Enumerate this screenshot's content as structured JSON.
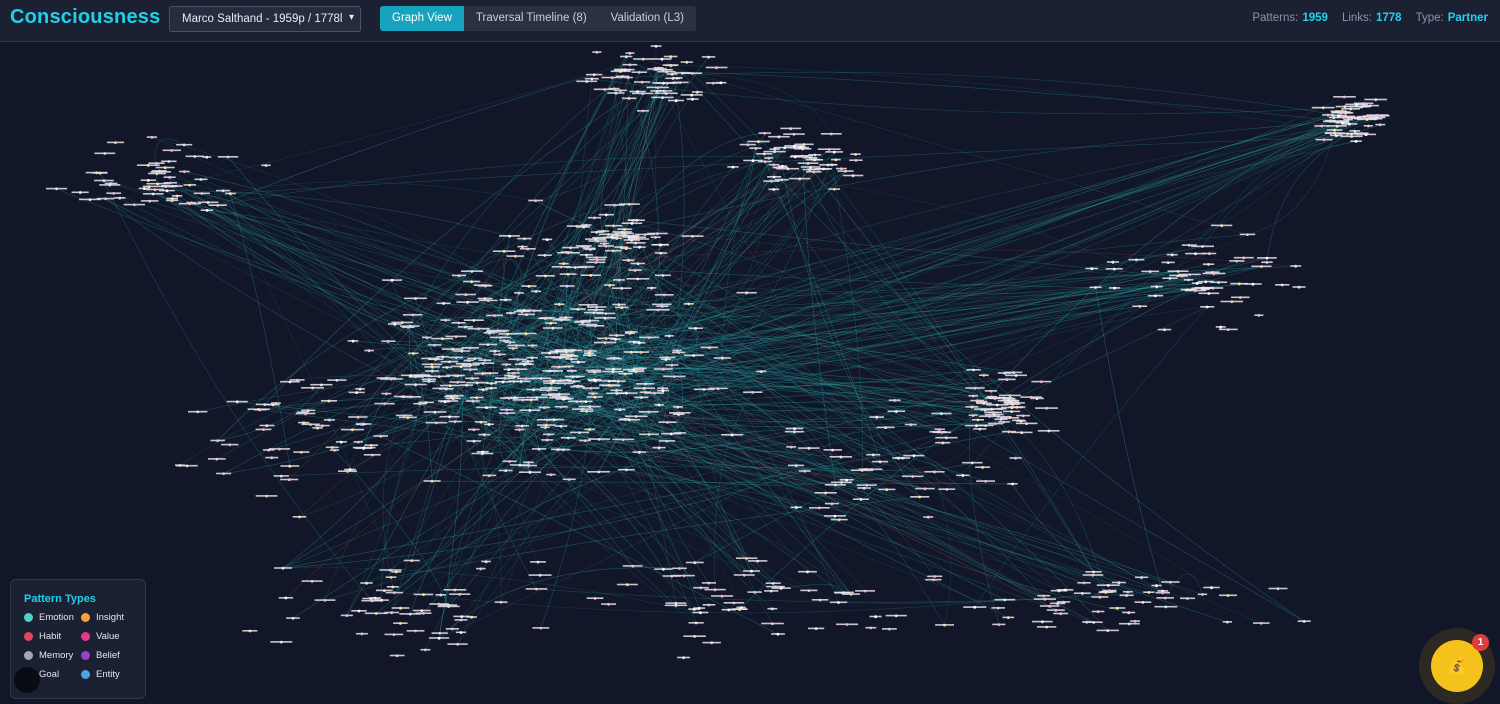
{
  "header": {
    "app_title": "Consciousness",
    "dataset_selector": {
      "selected": "Marco Salthand - 1959p / 1778l",
      "chevron_icon": "chevron-down-icon"
    },
    "tabs": [
      {
        "label": "Graph View",
        "active": true
      },
      {
        "label": "Traversal Timeline (8)",
        "active": false
      },
      {
        "label": "Validation (L3)",
        "active": false
      }
    ],
    "stats": {
      "patterns_label": "Patterns:",
      "patterns_value": "1959",
      "links_label": "Links:",
      "links_value": "1778",
      "type_label": "Type:",
      "type_value": "Partner"
    }
  },
  "legend": {
    "title": "Pattern Types",
    "items": [
      {
        "label": "Emotion",
        "color": "#4fd1c5"
      },
      {
        "label": "Insight",
        "color": "#f6a23a"
      },
      {
        "label": "Habit",
        "color": "#e0455a"
      },
      {
        "label": "Value",
        "color": "#e8388a"
      },
      {
        "label": "Memory",
        "color": "#a0a8b4"
      },
      {
        "label": "Belief",
        "color": "#9b40c9"
      },
      {
        "label": "Goal",
        "color": "#4fbf6a"
      },
      {
        "label": "Entity",
        "color": "#4aa3df"
      }
    ]
  },
  "graph": {
    "edge_color": "#2fa7a8",
    "node_colors": [
      "#f2e6d8",
      "#f6c9a8",
      "#d8c4f0",
      "#f5b5c8",
      "#cfe8f0",
      "#ffffff",
      "#ffe3a3"
    ],
    "node_count_shown": 1959,
    "link_count_shown": 1778
  },
  "floating_action": {
    "icon": "money-bag-icon",
    "glyph": "💰",
    "badge_count": "1"
  }
}
